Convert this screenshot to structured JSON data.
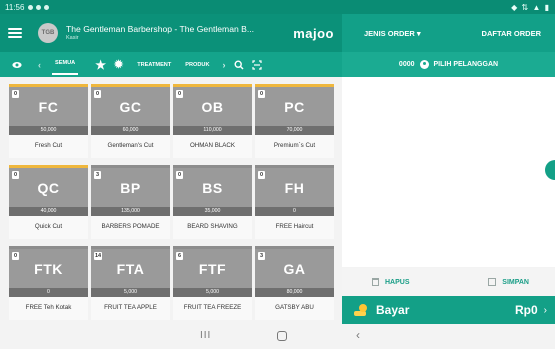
{
  "status_bar": {
    "time": "11:56",
    "system_icons": "◆ ⇅ ▲ ▮"
  },
  "app_bar": {
    "avatar_initials": "TGB",
    "store_name": "The Gentleman Barbershop - The Gentleman B...",
    "role": "Kasir",
    "brand": "majoo"
  },
  "order_header": {
    "jenis_order": "JENIS ORDER",
    "daftar_order": "DAFTAR ORDER"
  },
  "category_bar": {
    "tabs": [
      "SEMUA",
      "TREATMENT",
      "PRODUK"
    ],
    "icons": [
      "eye-icon",
      "star-icon",
      "gear-icon",
      "search-icon",
      "scan-icon"
    ]
  },
  "customer_bar": {
    "order_no": "0000",
    "label": "PILIH PELANGGAN"
  },
  "products": [
    {
      "code": "FC",
      "price": "50,000",
      "name": "Fresh Cut",
      "stock": "0",
      "bar": true
    },
    {
      "code": "GC",
      "price": "60,000",
      "name": "Gentleman's Cut",
      "stock": "0",
      "bar": true
    },
    {
      "code": "OB",
      "price": "110,000",
      "name": "OHMAN BLACK",
      "stock": "0",
      "bar": true
    },
    {
      "code": "PC",
      "price": "70,000",
      "name": "Premium`s Cut",
      "stock": "0",
      "bar": true
    },
    {
      "code": "QC",
      "price": "40,000",
      "name": "Quick Cut",
      "stock": "0",
      "bar": true
    },
    {
      "code": "BP",
      "price": "135,000",
      "name": "BARBERS POMADE",
      "stock": "3",
      "bar": false
    },
    {
      "code": "BS",
      "price": "35,000",
      "name": "BEARD SHAVING",
      "stock": "0",
      "bar": false
    },
    {
      "code": "FH",
      "price": "0",
      "name": "FREE Haircut",
      "stock": "0",
      "bar": false
    },
    {
      "code": "FTK",
      "price": "0",
      "name": "FREE Teh Kotak",
      "stock": "0",
      "bar": false
    },
    {
      "code": "FTA",
      "price": "5,000",
      "name": "FRUIT TEA APPLE",
      "stock": "14",
      "bar": false
    },
    {
      "code": "FTF",
      "price": "5,000",
      "name": "FRUIT TEA FREEZE",
      "stock": "6",
      "bar": false
    },
    {
      "code": "GA",
      "price": "80,000",
      "name": "GATSBY ABU",
      "stock": "3",
      "bar": false
    }
  ],
  "cart_actions": {
    "hapus": "HAPUS",
    "simpan": "SIMPAN"
  },
  "pay": {
    "label": "Bayar",
    "total": "Rp0",
    "coin_badge": "$"
  },
  "colors": {
    "primary": "#0b9179",
    "accent": "#13a087",
    "tile": "#9a9a9a",
    "highlight": "#efb73d"
  }
}
